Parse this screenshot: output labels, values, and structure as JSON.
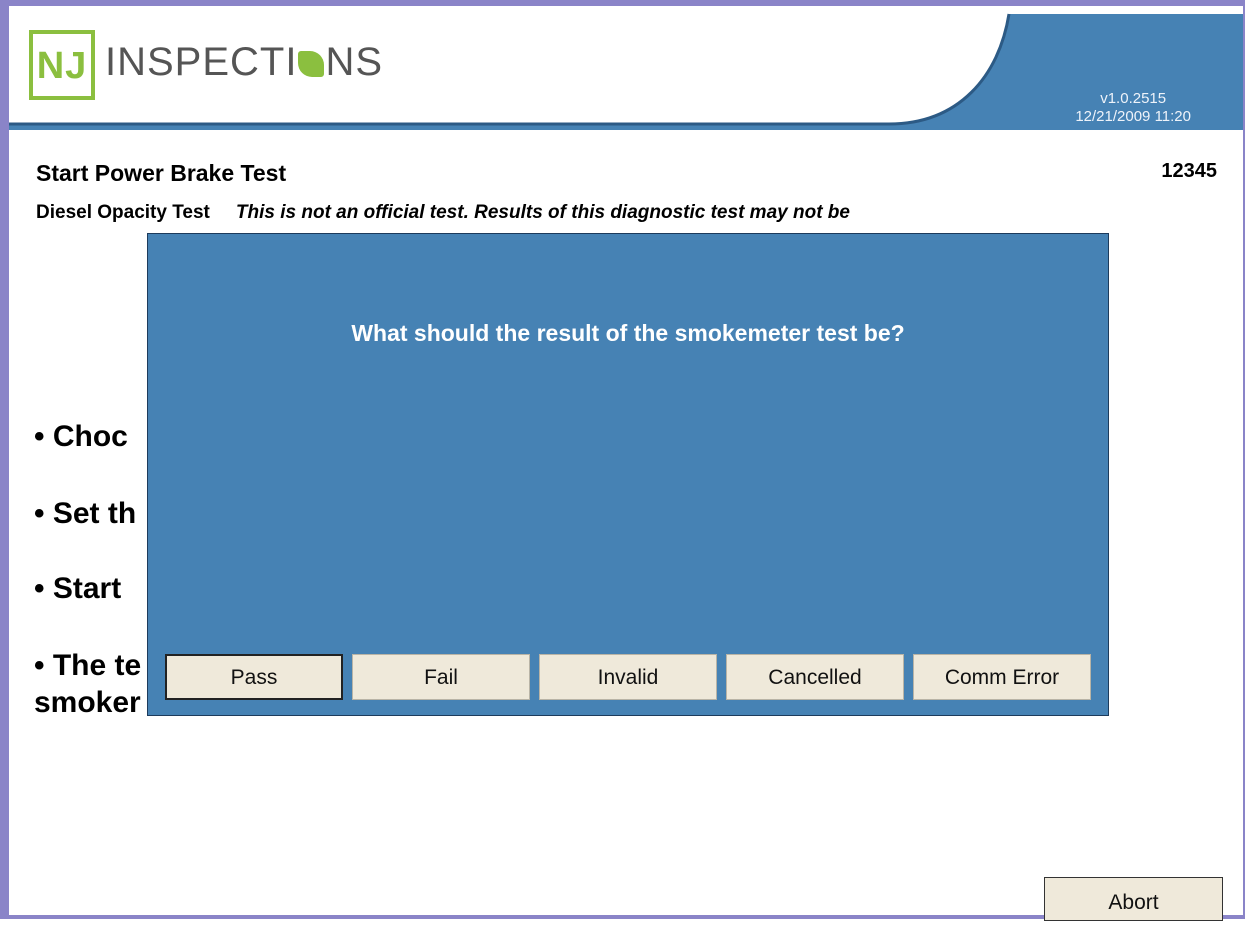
{
  "header": {
    "logo_box": "NJ",
    "logo_text_before": "INSPECTI",
    "logo_text_after": "NS",
    "version": "v1.0.2515",
    "datetime": "12/21/2009 11:20",
    "colors": {
      "band": "#4682b4",
      "logo_green": "#8bbf3f"
    }
  },
  "page": {
    "title": "Start Power Brake Test",
    "code": "12345",
    "test_label": "Diesel Opacity Test",
    "test_note": "This is not an official test. Results of this diagnostic test may not be",
    "bullets": [
      "• Choc",
      "• Set th",
      "• Start",
      "• The te"
    ],
    "bullet_cont": "smoker"
  },
  "modal": {
    "question": "What should the result of the smokemeter test be?",
    "buttons": [
      "Pass",
      "Fail",
      "Invalid",
      "Cancelled",
      "Comm Error"
    ]
  },
  "footer": {
    "abort_label": "Abort"
  }
}
